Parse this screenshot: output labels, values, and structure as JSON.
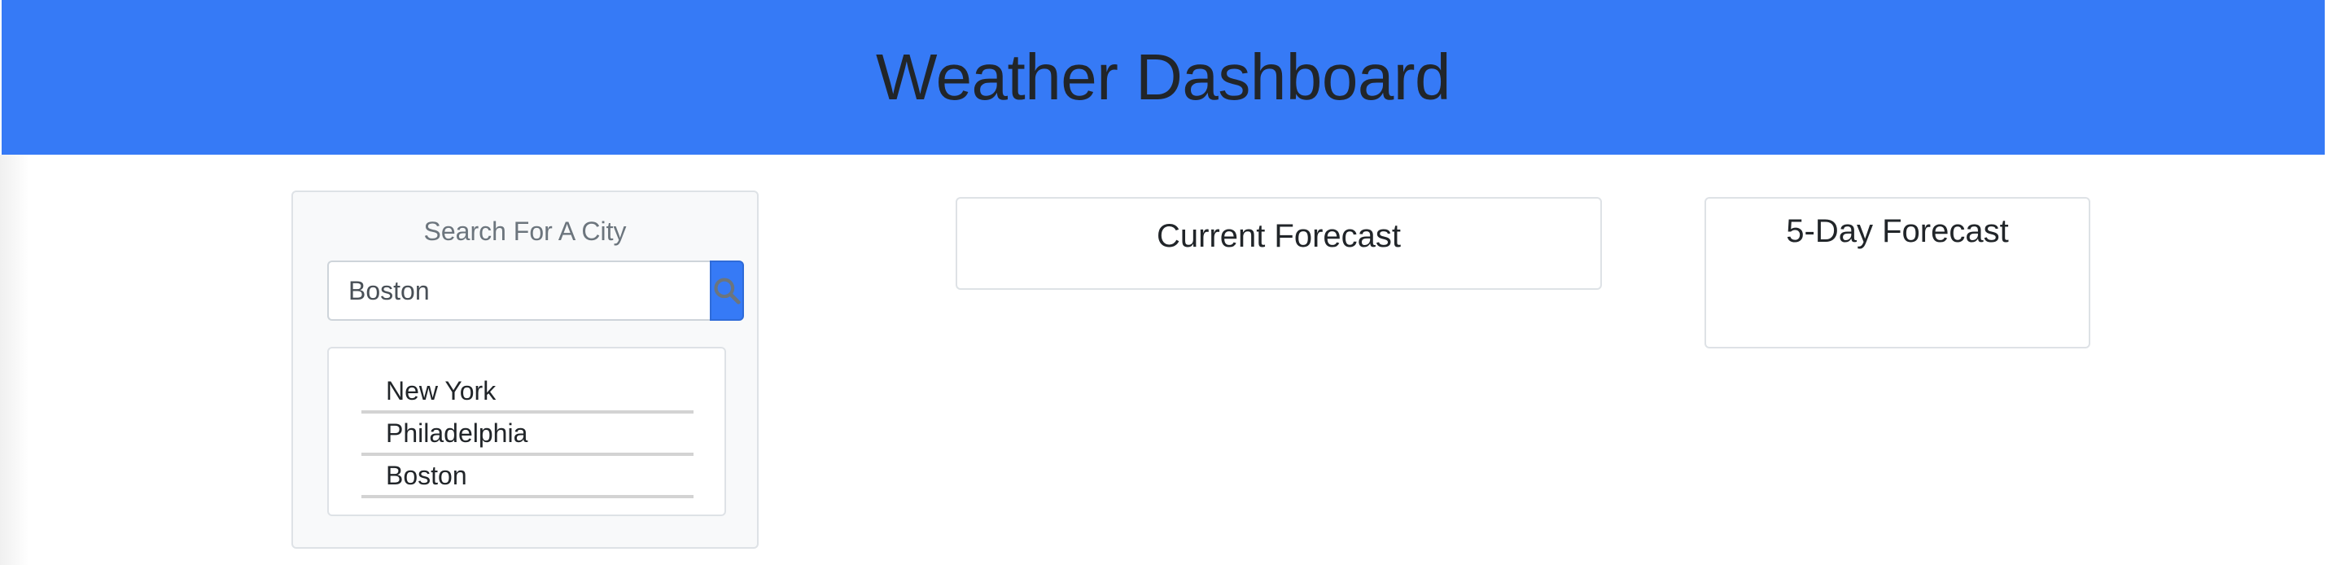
{
  "header": {
    "title": "Weather Dashboard",
    "background_color": "#367af6"
  },
  "search": {
    "title": "Search For A City",
    "input_value": "Boston",
    "button_icon": "search-icon"
  },
  "history": {
    "items": [
      {
        "label": "New York"
      },
      {
        "label": "Philadelphia"
      },
      {
        "label": "Boston"
      }
    ]
  },
  "current_forecast": {
    "title": "Current Forecast"
  },
  "five_day_forecast": {
    "title": "5-Day Forecast"
  }
}
